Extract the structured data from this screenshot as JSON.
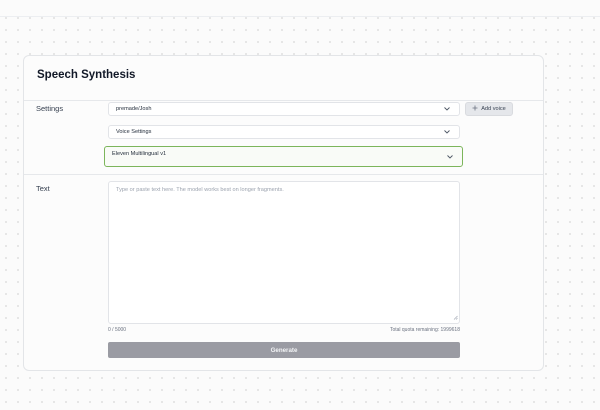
{
  "page": {
    "title": "Speech Synthesis"
  },
  "settings": {
    "label": "Settings",
    "voice_select": {
      "value": "premade/Josh"
    },
    "add_voice_label": "Add voice",
    "voice_settings": {
      "value": "Voice Settings"
    },
    "model_select": {
      "value": "Eleven Multilingual v1"
    }
  },
  "text_section": {
    "label": "Text",
    "placeholder": "Type or paste text here. The model works best on longer fragments.",
    "char_count": "0 / 5000",
    "quota": "Total quota remaining: 1999618"
  },
  "generate_label": "Generate",
  "colors": {
    "active_border": "#7cb55b",
    "generate_bg": "#9a9ba3"
  },
  "icons": [
    "chevron-down-icon",
    "plus-icon",
    "resize-handle-icon"
  ]
}
